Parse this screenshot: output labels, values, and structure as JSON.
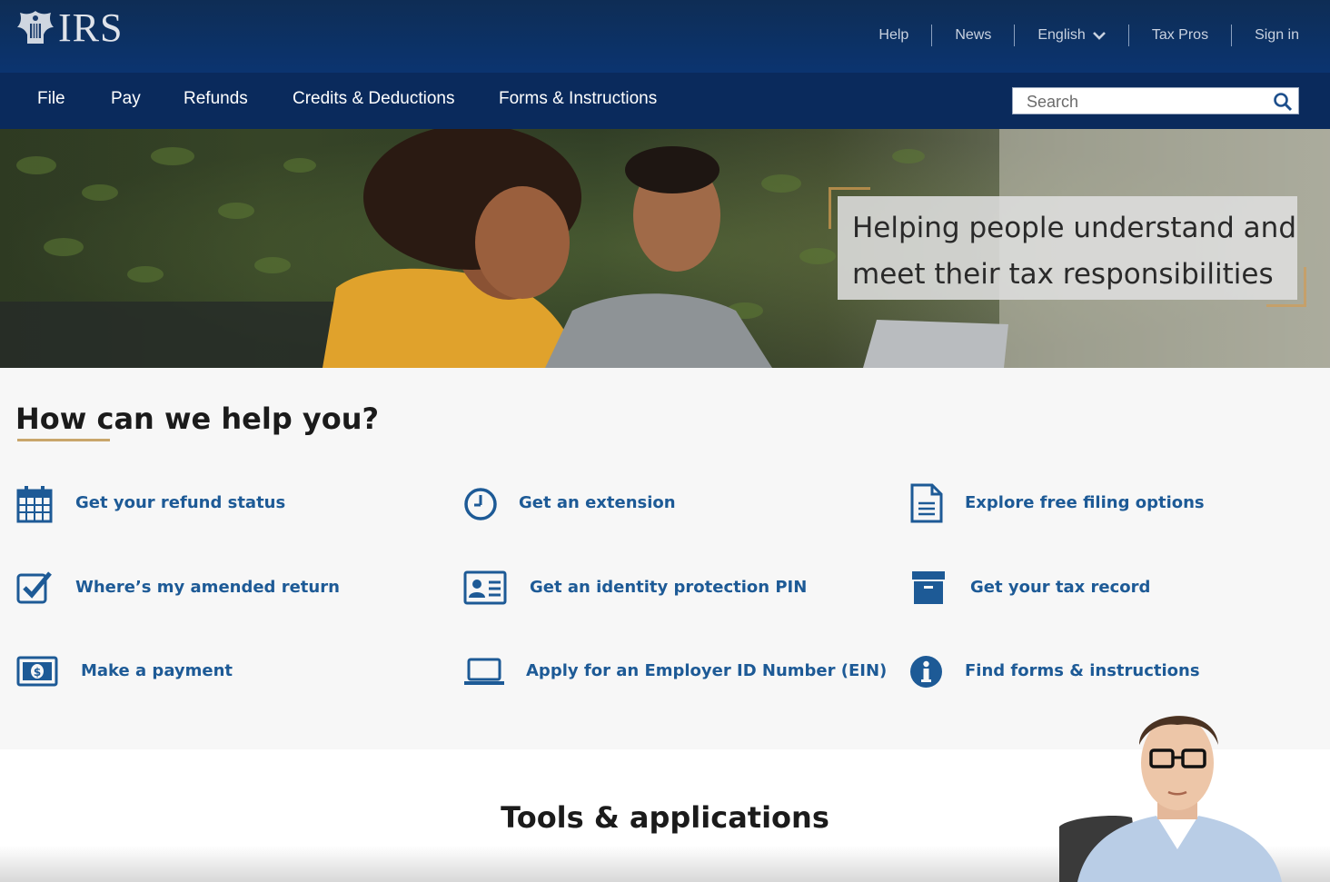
{
  "header": {
    "logo_text": "IRS",
    "utility_nav": [
      {
        "label": "Help"
      },
      {
        "label": "News"
      },
      {
        "label": "English"
      },
      {
        "label": "Tax Pros"
      },
      {
        "label": "Sign in"
      }
    ]
  },
  "main_nav": {
    "items": [
      {
        "label": "File"
      },
      {
        "label": "Pay"
      },
      {
        "label": "Refunds"
      },
      {
        "label": "Credits & Deductions"
      },
      {
        "label": "Forms & Instructions"
      }
    ],
    "search_placeholder": "Search"
  },
  "hero": {
    "caption": "Helping people understand and meet their tax responsibilities"
  },
  "help": {
    "title": "How can we help you?",
    "links": [
      {
        "label": "Get your refund status",
        "icon": "calendar-icon"
      },
      {
        "label": "Get an extension",
        "icon": "clock-icon"
      },
      {
        "label": "Explore free filing options",
        "icon": "document-icon"
      },
      {
        "label": "Where’s my amended return",
        "icon": "checkbox-icon"
      },
      {
        "label": "Get an identity protection PIN",
        "icon": "id-card-icon"
      },
      {
        "label": "Get your tax record",
        "icon": "archive-box-icon"
      },
      {
        "label": "Make a payment",
        "icon": "money-icon"
      },
      {
        "label": "Apply for an Employer ID Number (EIN)",
        "icon": "laptop-icon"
      },
      {
        "label": "Find forms & instructions",
        "icon": "info-icon"
      }
    ]
  },
  "tools": {
    "title": "Tools & applications"
  },
  "colors": {
    "top_bar": "#0b3470",
    "main_nav": "#0a2a5c",
    "link_blue": "#1d5a96",
    "accent_gold": "#c9a66b"
  }
}
